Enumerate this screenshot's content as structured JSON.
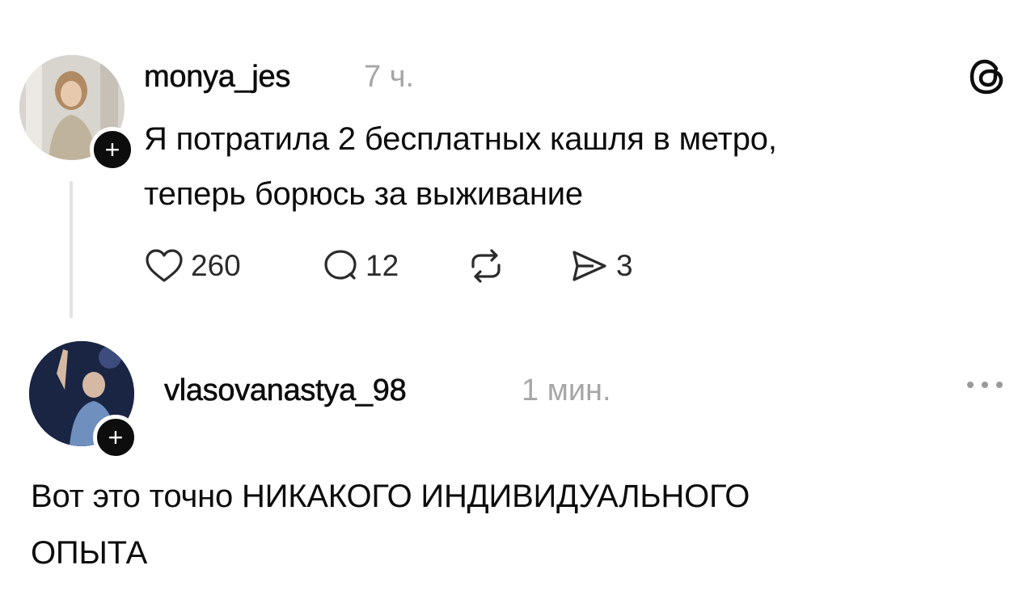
{
  "post1": {
    "username": "monya_jes",
    "time": "7 ч.",
    "text_line1": "Я потратила  2 бесплатных кашля в метро,",
    "text_line2": "теперь борюсь за выживание",
    "likes": "260",
    "comments": "12",
    "shares": "3"
  },
  "post2": {
    "username": "vlasovanastya_98",
    "time": "1 мин.",
    "text_line1": "Вот это точно  НИКАКОГО ИНДИВИДУАЛЬНОГО",
    "text_line2": "ОПЫТА"
  },
  "icons": {
    "threads": "threads-logo-icon",
    "like": "heart-icon",
    "comment": "comment-icon",
    "repost": "repost-icon",
    "share": "send-icon",
    "more": "more-dots-icon",
    "follow": "plus-icon"
  },
  "colors": {
    "text": "#0d0d0d",
    "secondary": "#a6a6a6",
    "thread_line": "#e3e3e3"
  }
}
